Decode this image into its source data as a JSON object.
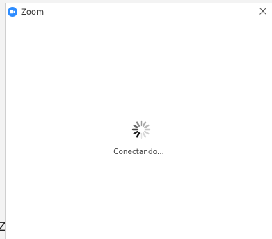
{
  "window": {
    "title": "Zoom",
    "close_glyph": "✕",
    "app_icon": "zoom-logo-icon",
    "accent_color": "#2D8CFF"
  },
  "status": {
    "text": "Conectando...",
    "icon": "loading-spinner-icon"
  },
  "background": {
    "fragment_text": "Zo"
  }
}
